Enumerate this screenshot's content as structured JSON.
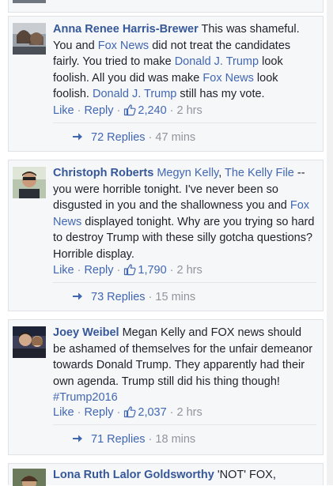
{
  "comments": [
    {
      "author": "Anna Renee Harris-Brewer",
      "text_parts": [
        {
          "t": " This was shameful. You and ",
          "tag": false
        },
        {
          "t": "Fox News",
          "tag": true
        },
        {
          "t": " did not treat the candidates fairly. You tried to make ",
          "tag": false
        },
        {
          "t": "Donald J. Trump",
          "tag": true
        },
        {
          "t": " look foolish. All you did was make ",
          "tag": false
        },
        {
          "t": "Fox News",
          "tag": true
        },
        {
          "t": " look foolish. ",
          "tag": false
        },
        {
          "t": "Donald J. Trump",
          "tag": true
        },
        {
          "t": " still has my vote.",
          "tag": false
        }
      ],
      "like_label": "Like",
      "reply_label": "Reply",
      "like_count": "2,240",
      "time": "2 hrs",
      "replies_label": "72 Replies",
      "replies_time": "47 mins"
    },
    {
      "author": "Christoph Roberts",
      "text_parts": [
        {
          "t": " ",
          "tag": false
        },
        {
          "t": "Megyn Kelly",
          "tag": true
        },
        {
          "t": ", ",
          "tag": false
        },
        {
          "t": "The Kelly File",
          "tag": true
        },
        {
          "t": " -- you were horrible tonight. I've never been so disgusted in you and the shallowness you and ",
          "tag": false
        },
        {
          "t": "Fox News",
          "tag": true
        },
        {
          "t": " displayed tonight. Why are you trying so hard to destroy Trump with these silly gotcha questions? Horrible display.",
          "tag": false
        }
      ],
      "like_label": "Like",
      "reply_label": "Reply",
      "like_count": "1,790",
      "time": "2 hrs",
      "replies_label": "73 Replies",
      "replies_time": "15 mins"
    },
    {
      "author": "Joey Weibel",
      "text_parts": [
        {
          "t": " Megan Kelly and FOX news should be ashamed of themselves for the unfair demeanor towards Donald Trump. They apparently had their own agenda. Trump still did his thing though! ",
          "tag": false
        },
        {
          "t": "#Trump2016",
          "tag": true
        }
      ],
      "like_label": "Like",
      "reply_label": "Reply",
      "like_count": "2,037",
      "time": "2 hrs",
      "replies_label": "71 Replies",
      "replies_time": "18 mins"
    },
    {
      "author": "Lona Ruth Lalor Goldsworthy",
      "text_parts": [
        {
          "t": " 'NOT' FOX,",
          "tag": false
        }
      ]
    }
  ],
  "colors": {
    "link": "#4267b2",
    "author": "#365899",
    "meta": "#90949c",
    "card_bg": "#f6f7f9"
  },
  "icons": {
    "like": "thumbs-up-icon",
    "reply": "reply-arrow-icon"
  }
}
